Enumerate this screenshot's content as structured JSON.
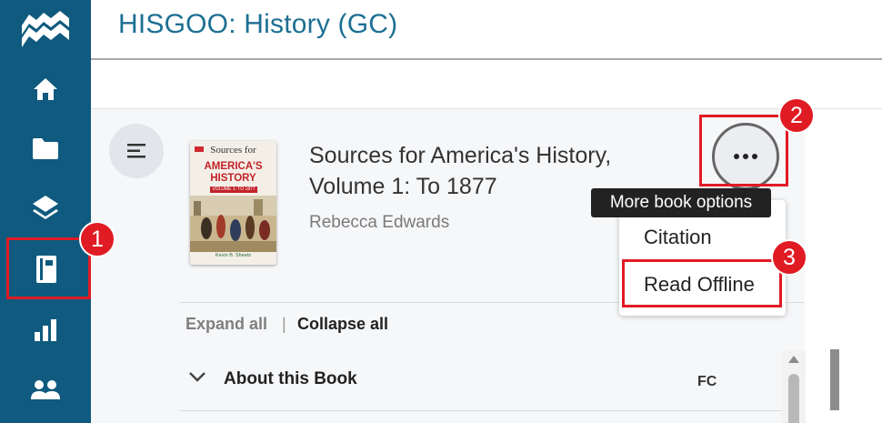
{
  "header": {
    "course_title": "HISGOO: History (GC)"
  },
  "sidebar": {
    "items": [
      {
        "name": "home",
        "icon": "home-icon"
      },
      {
        "name": "folders",
        "icon": "folder-icon"
      },
      {
        "name": "learning",
        "icon": "layers-icon"
      },
      {
        "name": "books",
        "icon": "book-icon",
        "active": true
      },
      {
        "name": "reports",
        "icon": "bar-chart-icon"
      },
      {
        "name": "people",
        "icon": "people-icon"
      }
    ]
  },
  "book": {
    "title": "Sources for America's History, Volume 1: To 1877",
    "author": "Rebecca Edwards",
    "cover": {
      "line1": "Sources for",
      "line2": "AMERICA'S",
      "line3": "HISTORY",
      "subtitle": "VOLUME 1: TO 1877",
      "author": "Kevin B. Sheets"
    }
  },
  "more_options": {
    "tooltip": "More book options"
  },
  "menu": {
    "items": [
      "Citation",
      "Read Offline"
    ]
  },
  "toc_controls": {
    "expand_all": "Expand all",
    "separator": "|",
    "collapse_all": "Collapse all"
  },
  "sections": [
    {
      "label": "About this Book",
      "code": "FC"
    }
  ],
  "annotations": {
    "badges": [
      "1",
      "2",
      "3"
    ],
    "color": "#e01b24"
  },
  "colors": {
    "sidebar": "#0f5a7e",
    "title": "#1d6f93",
    "highlight": "#e01b24"
  }
}
